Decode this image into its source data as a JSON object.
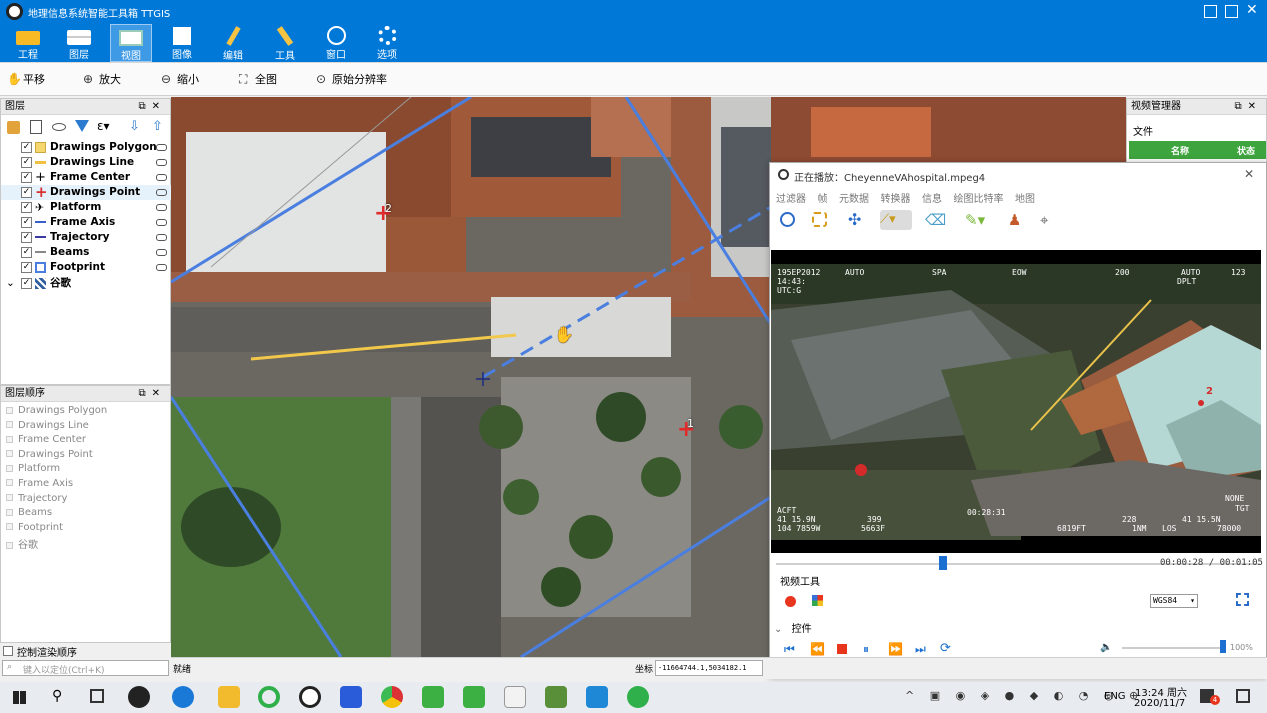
{
  "app": {
    "title": "地理信息系统智能工具箱 TTGIS",
    "ribbon": [
      {
        "label": "工程",
        "icon": "folder-icon"
      },
      {
        "label": "图层",
        "icon": "layers-icon"
      },
      {
        "label": "视图",
        "icon": "view-icon",
        "active": true
      },
      {
        "label": "图像",
        "icon": "image-icon"
      },
      {
        "label": "编辑",
        "icon": "pencil-icon"
      },
      {
        "label": "工具",
        "icon": "tools-icon"
      },
      {
        "label": "窗口",
        "icon": "aperture-icon"
      },
      {
        "label": "选项",
        "icon": "gear-icon"
      }
    ],
    "toolbar": [
      {
        "label": "平移",
        "icon": "hand-icon"
      },
      {
        "label": "放大",
        "icon": "zoom-in-icon"
      },
      {
        "label": "缩小",
        "icon": "zoom-out-icon"
      },
      {
        "label": "全图",
        "icon": "full-extent-icon"
      },
      {
        "label": "原始分辨率",
        "icon": "native-resolution-icon"
      }
    ]
  },
  "layers_panel": {
    "title": "图层",
    "items": [
      {
        "label": "Drawings Polygon",
        "symbol": "polygon",
        "color": "#f5d76e"
      },
      {
        "label": "Drawings Line",
        "symbol": "line",
        "color": "#f0c040"
      },
      {
        "label": "Frame Center",
        "symbol": "cross",
        "color": "#333333"
      },
      {
        "label": "Drawings Point",
        "symbol": "point",
        "color": "#d93030",
        "selected": true
      },
      {
        "label": "Platform",
        "symbol": "plane",
        "color": "#333333"
      },
      {
        "label": "Frame Axis",
        "symbol": "line",
        "color": "#3a5fcd"
      },
      {
        "label": "Trajectory",
        "symbol": "line",
        "color": "#3a3aa0"
      },
      {
        "label": "Beams",
        "symbol": "line",
        "color": "#888888"
      },
      {
        "label": "Footprint",
        "symbol": "rect",
        "color": "#4a7fe0"
      },
      {
        "label": "谷歌",
        "symbol": "raster",
        "color": "#2f5fa0"
      }
    ]
  },
  "order_panel": {
    "title": "图层顺序",
    "items": [
      "Drawings Polygon",
      "Drawings Line",
      "Frame Center",
      "Drawings Point",
      "Platform",
      "Frame Axis",
      "Trajectory",
      "Beams",
      "Footprint",
      "谷歌"
    ],
    "control_order_label": "控制渲染顺序",
    "search_placeholder": "键入以定位(Ctrl+K)"
  },
  "status": {
    "ready": "就绪",
    "coord_label": "坐标",
    "coord_value": "-11664744.1,5034182.1"
  },
  "video_manager": {
    "title": "视频管理器",
    "file_label": "文件",
    "col_name": "名称",
    "col_status": "状态"
  },
  "player": {
    "title": "正在播放：CheyenneVAhospital.mpeg4",
    "menu": [
      "过滤器",
      "帧",
      "元数据",
      "转换器",
      "信息",
      "绘图比特率",
      "地图"
    ],
    "osd_top": [
      "195EP2012",
      "AUTO",
      "SPA",
      "EOW",
      "200",
      "AUTO",
      "123"
    ],
    "osd_tl": [
      "14:43:",
      "UTC:G"
    ],
    "osd_bottom": [
      "ACFT",
      "41 15.9N",
      "104 7859W",
      "399",
      "5663F",
      "00:28:31",
      "6819FT",
      "228",
      "1NM",
      "LOS",
      "41 15.5N",
      "78000"
    ],
    "osd_right": [
      "DPLT",
      "NONE",
      "TGT"
    ],
    "time_current": "00:00:28",
    "time_total": "00:01:05",
    "progress": 0.43,
    "video_tools_label": "视频工具",
    "crs": "WGS84",
    "controls_label": "控件",
    "volume_percent": "100%",
    "marker2": "2"
  },
  "map": {
    "marker1": "1",
    "marker2": "2"
  },
  "taskbar": {
    "lang": "ENG",
    "time": "13:24 周六",
    "date": "2020/11/7",
    "notify_badge": "4"
  }
}
